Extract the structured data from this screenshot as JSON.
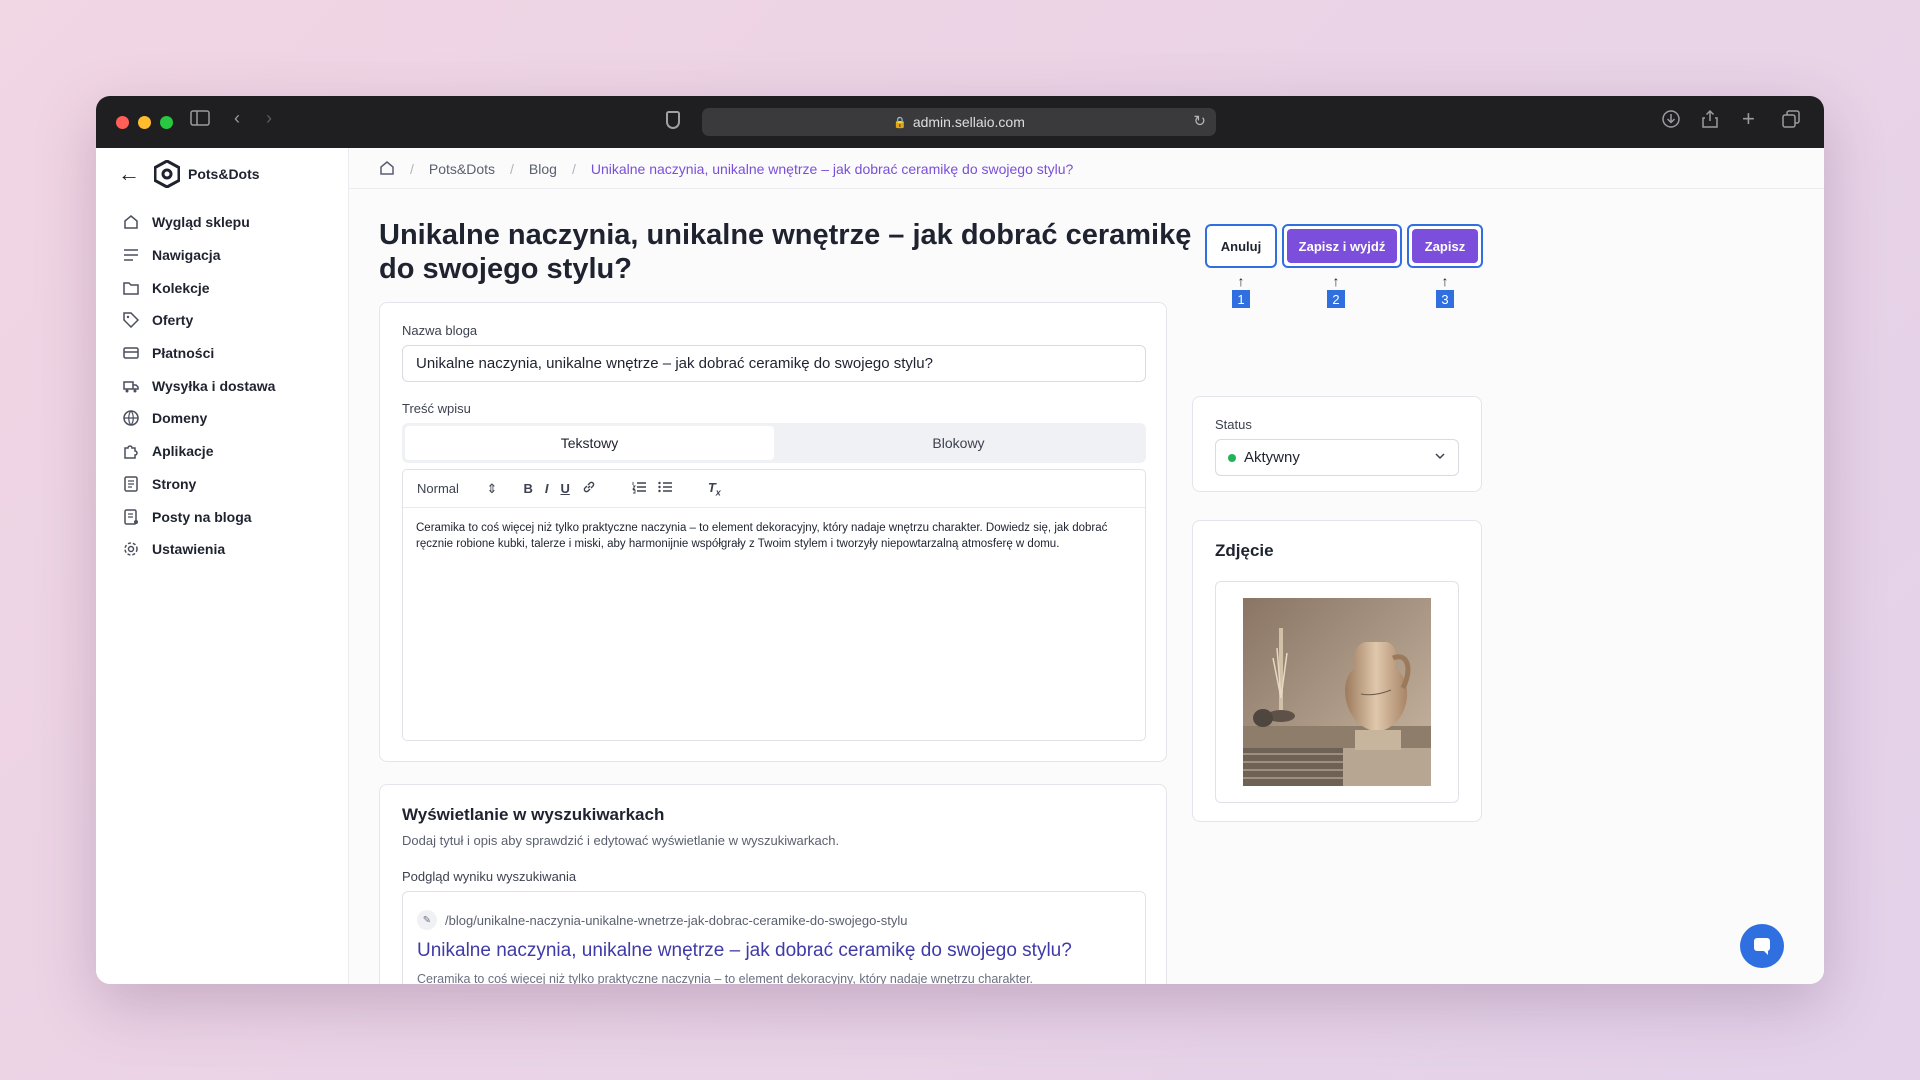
{
  "browser": {
    "url": "admin.sellaio.com",
    "traffic_colors": [
      "#ff5f57",
      "#febc2e",
      "#28c840"
    ]
  },
  "sidebar": {
    "brand": "Pots&Dots",
    "items": [
      {
        "label": "Wygląd sklepu",
        "icon": "storefront-icon"
      },
      {
        "label": "Nawigacja",
        "icon": "menu-lines-icon"
      },
      {
        "label": "Kolekcje",
        "icon": "folder-icon"
      },
      {
        "label": "Oferty",
        "icon": "tag-icon"
      },
      {
        "label": "Płatności",
        "icon": "card-icon"
      },
      {
        "label": "Wysyłka i dostawa",
        "icon": "truck-icon"
      },
      {
        "label": "Domeny",
        "icon": "globe-icon"
      },
      {
        "label": "Aplikacje",
        "icon": "puzzle-icon"
      },
      {
        "label": "Strony",
        "icon": "page-icon"
      },
      {
        "label": "Posty na bloga",
        "icon": "post-icon"
      },
      {
        "label": "Ustawienia",
        "icon": "gear-icon"
      }
    ]
  },
  "breadcrumb": {
    "items": [
      "Pots&Dots",
      "Blog"
    ],
    "current": "Unikalne naczynia, unikalne wnętrze – jak dobrać ceramikę do swojego stylu?"
  },
  "page": {
    "title": "Unikalne naczynia, unikalne wnętrze – jak dobrać ceramikę do swojego stylu?"
  },
  "actions": {
    "cancel": "Anuluj",
    "save_exit": "Zapisz i wyjdź",
    "save": "Zapisz",
    "annotations": [
      "1",
      "2",
      "3"
    ],
    "accent": "#7b4fdb",
    "annotation_color": "#2f6fe0"
  },
  "form": {
    "name_label": "Nazwa bloga",
    "name_value": "Unikalne naczynia, unikalne wnętrze – jak dobrać ceramikę do swojego stylu?",
    "content_label": "Treść wpisu",
    "tab_text": "Tekstowy",
    "tab_block": "Blokowy",
    "toolbar_format": "Normal",
    "content_body": "Ceramika to coś więcej niż tylko praktyczne naczynia – to element dekoracyjny, który nadaje wnętrzu charakter. Dowiedz się, jak dobrać ręcznie robione kubki, talerze i miski, aby harmonijnie współgrały z Twoim stylem i tworzyły niepowtarzalną atmosferę w domu."
  },
  "seo": {
    "title": "Wyświetlanie w wyszukiwarkach",
    "desc": "Dodaj tytuł i opis aby sprawdzić i edytować wyświetlanie w wyszukiwarkach.",
    "preview_label": "Podgląd wyniku wyszukiwania",
    "url": "/blog/unikalne-naczynia-unikalne-wnetrze-jak-dobrac-ceramike-do-swojego-stylu",
    "link_title": "Unikalne naczynia, unikalne wnętrze – jak dobrać ceramikę do swojego stylu?",
    "snippet": "Ceramika to coś więcej niż tylko praktyczne naczynia – to element dekoracyjny, który nadaje wnętrzu charakter."
  },
  "status": {
    "label": "Status",
    "value": "Aktywny",
    "dot_color": "#22b35a"
  },
  "photo": {
    "title": "Zdjęcie"
  }
}
